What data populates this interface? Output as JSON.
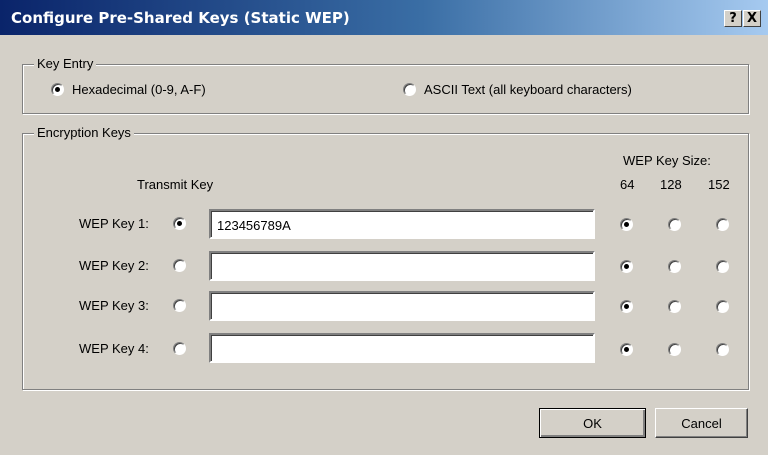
{
  "window": {
    "title": "Configure Pre-Shared Keys (Static WEP)",
    "help_label": "?",
    "close_label": "X"
  },
  "key_entry": {
    "legend": "Key Entry",
    "hex_label": "Hexadecimal (0-9, A-F)",
    "hex_selected": true,
    "ascii_label": "ASCII Text (all keyboard characters)",
    "ascii_selected": false
  },
  "encryption": {
    "legend": "Encryption Keys",
    "transmit_header": "Transmit Key",
    "size_header": "WEP Key Size:",
    "sizes": [
      "64",
      "128",
      "152"
    ],
    "keys": [
      {
        "label": "WEP Key 1:",
        "value": "123456789A",
        "transmit": true,
        "size": "64"
      },
      {
        "label": "WEP Key 2:",
        "value": "",
        "transmit": false,
        "size": "64"
      },
      {
        "label": "WEP Key 3:",
        "value": "",
        "transmit": false,
        "size": "64"
      },
      {
        "label": "WEP Key 4:",
        "value": "",
        "transmit": false,
        "size": "64"
      }
    ]
  },
  "buttons": {
    "ok": "OK",
    "cancel": "Cancel"
  }
}
